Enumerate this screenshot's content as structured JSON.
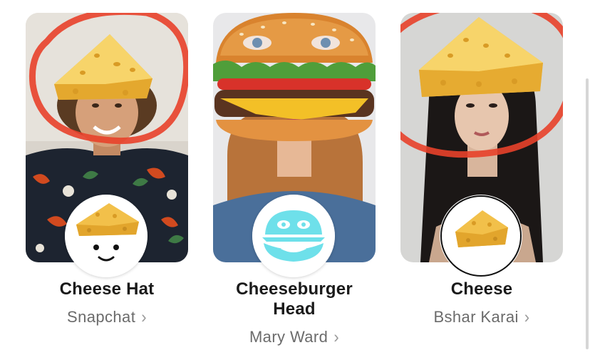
{
  "lenses": [
    {
      "title": "Cheese Hat",
      "creator": "Snapchat",
      "icon": "cheese-hat-face-icon"
    },
    {
      "title": "Cheeseburger Head",
      "creator": "Mary Ward",
      "icon": "burger-face-icon"
    },
    {
      "title": "Cheese",
      "creator": "Bshar Karai",
      "icon": "cheese-wedge-icon"
    }
  ],
  "chevron": "›",
  "annotation_color": "#e8412a"
}
